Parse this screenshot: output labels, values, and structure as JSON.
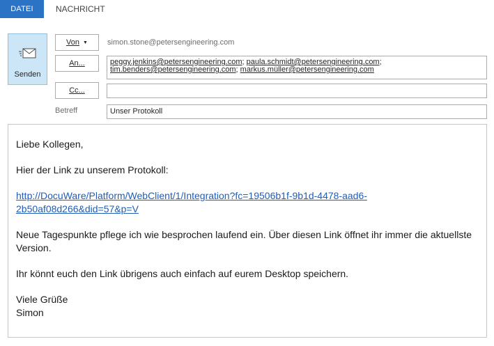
{
  "ribbon": {
    "tabs": [
      {
        "label": "DATEI",
        "active": true
      },
      {
        "label": "NACHRICHT",
        "active": false
      }
    ]
  },
  "compose": {
    "send_label": "Senden",
    "from_label": "Von",
    "to_label": "An...",
    "cc_label": "Cc...",
    "subject_label": "Betreff",
    "from_address": "simon.stone@petersengineering.com",
    "recipients": [
      "peggy.jenkins@petersengineering.com",
      "paula.schmidt@petersengineering.com",
      "tim.benders@petersengineering.com",
      "markus.müller@petersengineering.com"
    ],
    "cc_value": "",
    "subject": "Unser Protokoll"
  },
  "message": {
    "greeting": "Liebe Kollegen,",
    "intro": "Hier der Link zu unserem Protokoll:",
    "link_line1": "http://DocuWare/Platform/WebClient/1/Integration?fc=19506b1f-9b1d-4478-aad6-",
    "link_line2": "2b50af08d266&did=57&p=V",
    "para1": "Neue Tagespunkte pflege ich wie besprochen laufend ein. Über diesen Link öffnet ihr immer die aktuellste Version.",
    "para2": "Ihr könnt euch den Link übrigens auch einfach auf eurem Desktop speichern.",
    "closing": "Viele Grüße",
    "signature": "Simon"
  },
  "colors": {
    "accent": "#2a73c5",
    "send_button_bg": "#cde6f7",
    "link": "#1f5db9"
  }
}
